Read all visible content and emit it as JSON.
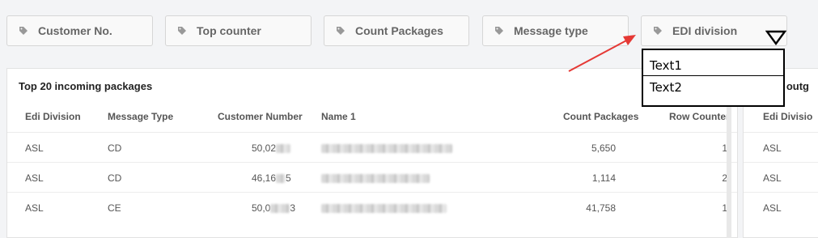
{
  "filters": [
    {
      "label": "Customer No.",
      "icon": "tag-icon"
    },
    {
      "label": "Top counter",
      "icon": "tag-icon"
    },
    {
      "label": "Count Packages",
      "icon": "tag-icon"
    },
    {
      "label": "Message type",
      "icon": "tag-icon"
    },
    {
      "label": "EDI division",
      "icon": "tag-icon"
    }
  ],
  "dropdown": {
    "items": [
      "Text1",
      "Text2"
    ]
  },
  "incoming": {
    "title": "Top 20 incoming packages",
    "headers": [
      "Edi Division",
      "Message Type",
      "Customer Number",
      "Name 1",
      "Count Packages",
      "Row Counter"
    ],
    "rows": [
      {
        "edi": "ASL",
        "msg": "CD",
        "cust_prefix": "50,02",
        "count": "5,650",
        "row": "1"
      },
      {
        "edi": "ASL",
        "msg": "CD",
        "cust_prefix": "46,16",
        "cust_suffix": "5",
        "count": "1,114",
        "row": "2"
      },
      {
        "edi": "ASL",
        "msg": "CE",
        "cust_prefix": "50,0",
        "cust_suffix": "3",
        "count": "41,758",
        "row": "1"
      }
    ]
  },
  "outgoing": {
    "title": "0 outg",
    "header": "Edi Divisio",
    "rows": [
      "ASL",
      "ASL",
      "ASL"
    ]
  },
  "colors": {
    "annotation_arrow": "#e53935",
    "accent_row_counter": "#555555"
  }
}
